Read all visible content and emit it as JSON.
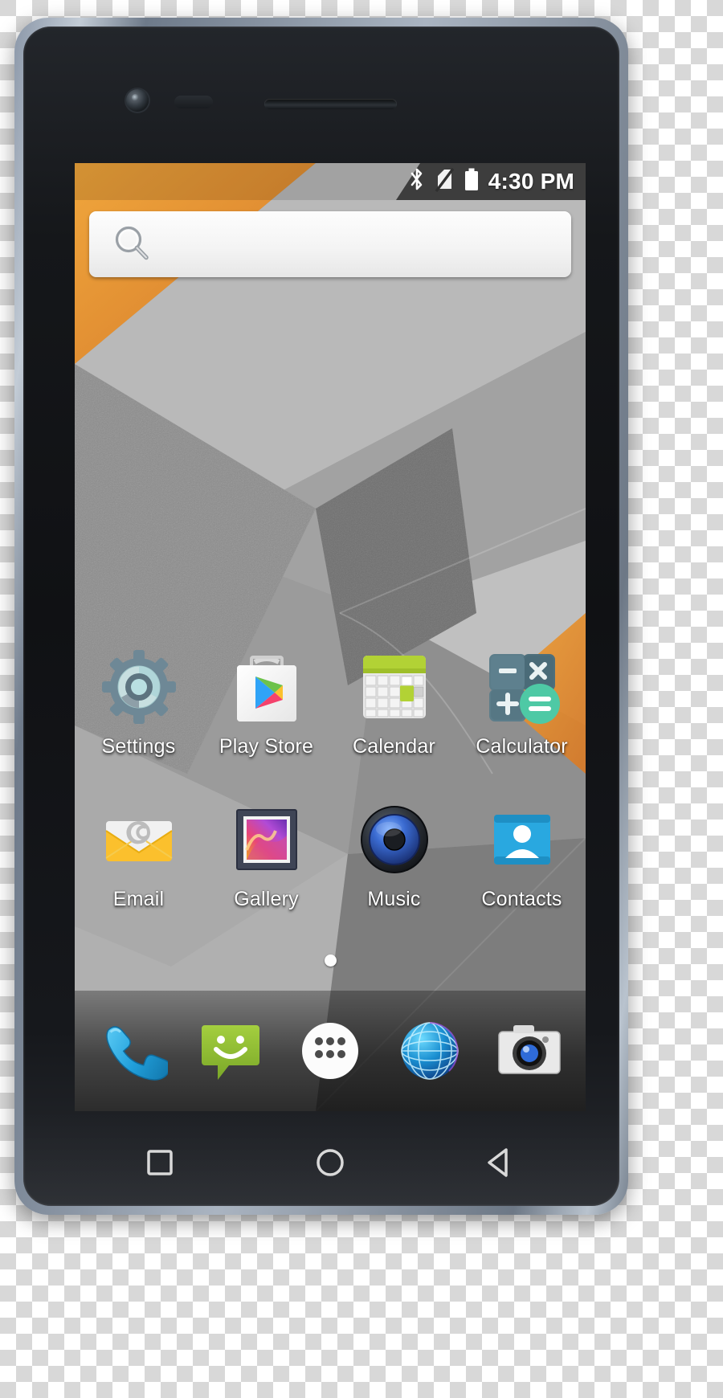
{
  "device": {
    "name": "Android smartphone",
    "hardware": {
      "front_camera": "front-camera",
      "proximity_sensor": "proximity-sensor",
      "earpiece_speaker": "earpiece-speaker"
    }
  },
  "statusbar": {
    "time": "4:30 PM",
    "icons": [
      {
        "name": "bluetooth-icon",
        "label": "Bluetooth"
      },
      {
        "name": "no-sim-icon",
        "label": "No SIM card"
      },
      {
        "name": "battery-full-icon",
        "label": "Battery full"
      }
    ]
  },
  "search": {
    "name": "google-search-bar",
    "value": "",
    "placeholder": "",
    "icon": "search-icon"
  },
  "homescreen": {
    "rows": [
      {
        "apps": [
          {
            "label": "Settings",
            "icon": "settings-gear-icon"
          },
          {
            "label": "Play Store",
            "icon": "play-store-icon"
          },
          {
            "label": "Calendar",
            "icon": "calendar-icon"
          },
          {
            "label": "Calculator",
            "icon": "calculator-icon"
          }
        ]
      },
      {
        "apps": [
          {
            "label": "Email",
            "icon": "email-envelope-icon"
          },
          {
            "label": "Gallery",
            "icon": "gallery-photo-icon"
          },
          {
            "label": "Music",
            "icon": "music-speaker-icon"
          },
          {
            "label": "Contacts",
            "icon": "contacts-person-icon"
          }
        ]
      }
    ],
    "page_indicator": {
      "pages": 1,
      "current": 1
    }
  },
  "dock": {
    "items": [
      {
        "label": "Phone",
        "icon": "phone-handset-icon"
      },
      {
        "label": "Messaging",
        "icon": "messaging-bubble-icon"
      },
      {
        "label": "Apps",
        "icon": "app-drawer-icon"
      },
      {
        "label": "Browser",
        "icon": "browser-globe-icon"
      },
      {
        "label": "Camera",
        "icon": "camera-icon"
      }
    ]
  },
  "navbar": {
    "buttons": [
      {
        "label": "Recents",
        "icon": "square-recents-icon"
      },
      {
        "label": "Home",
        "icon": "circle-home-icon"
      },
      {
        "label": "Back",
        "icon": "triangle-back-icon"
      }
    ]
  },
  "colors": {
    "accent_orange": "#e8922e",
    "wallpaper_grey_light": "#c9c9c9",
    "wallpaper_grey_mid": "#9a9a9a",
    "wallpaper_grey_dark": "#6e6e6e",
    "status_text": "#ffffff",
    "label_text": "#ffffff",
    "play_green": "#8bc34a",
    "play_blue": "#2196f3",
    "play_yellow": "#ffc107",
    "play_red": "#f4426c",
    "calendar_green": "#b2d235",
    "calculator_teal": "#4ec9a5",
    "calculator_slate": "#5c7d8a",
    "email_yellow": "#fbc02d",
    "contacts_blue": "#29a8e0",
    "messaging_green": "#8bc34a",
    "phone_blue": "#29a8e0"
  }
}
